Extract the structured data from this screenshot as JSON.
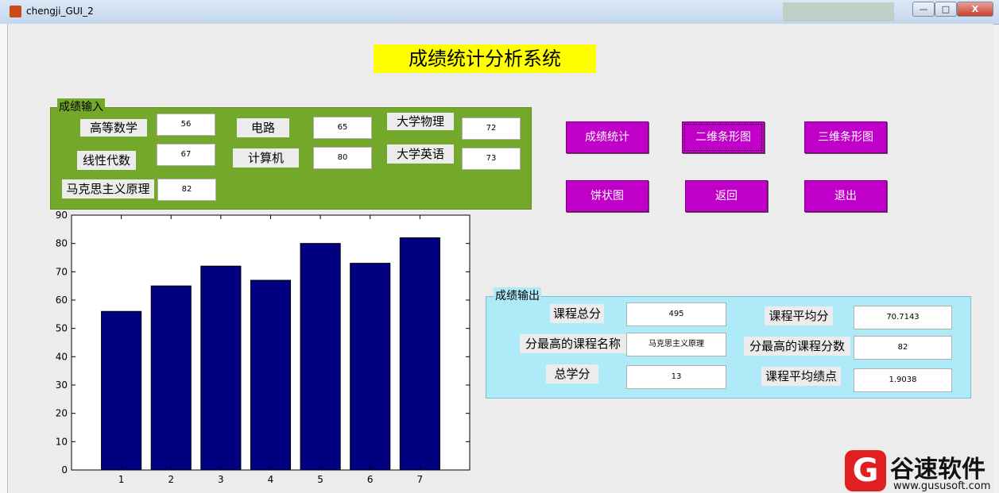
{
  "window": {
    "title": "chengji_GUI_2",
    "btn_min": "—",
    "btn_max": "□",
    "btn_close": "X"
  },
  "system_title": "成绩统计分析系统",
  "input_panel": {
    "legend": "成绩输入",
    "subjects": [
      {
        "label": "高等数学",
        "value": "56"
      },
      {
        "label": "电路",
        "value": "65"
      },
      {
        "label": "大学物理",
        "value": "72"
      },
      {
        "label": "线性代数",
        "value": "67"
      },
      {
        "label": "计算机",
        "value": "80"
      },
      {
        "label": "大学英语",
        "value": "73"
      },
      {
        "label": "马克思主义原理",
        "value": "82"
      }
    ]
  },
  "buttons": {
    "stat": "成绩统计",
    "bar2d": "二维条形图",
    "bar3d": "三维条形图",
    "pie": "饼状图",
    "back": "返回",
    "exit": "退出"
  },
  "output_panel": {
    "legend": "成绩输出",
    "total_label": "课程总分",
    "total_value": "495",
    "avg_label": "课程平均分",
    "avg_value": "70.7143",
    "max_name_label": "分最高的课程名称",
    "max_name_value": "马克思主义原理",
    "max_score_label": "分最高的课程分数",
    "max_score_value": "82",
    "credits_label": "总学分",
    "credits_value": "13",
    "gpa_label": "课程平均绩点",
    "gpa_value": "1.9038"
  },
  "colors": {
    "bar": "#000080",
    "input_panel": "#74a82a",
    "output_panel": "#aeeaf8",
    "button": "#c000c8",
    "title_bg": "#ffff00"
  },
  "chart_data": {
    "type": "bar",
    "categories": [
      "1",
      "2",
      "3",
      "4",
      "5",
      "6",
      "7"
    ],
    "values": [
      56,
      65,
      72,
      67,
      80,
      73,
      82
    ],
    "ylim": [
      0,
      90
    ],
    "yticks": [
      "0",
      "10",
      "20",
      "30",
      "40",
      "50",
      "60",
      "70",
      "80",
      "90"
    ],
    "grid": false
  },
  "watermark": {
    "logo": "G",
    "text": "谷速软件",
    "url": "www.gususoft.com"
  }
}
